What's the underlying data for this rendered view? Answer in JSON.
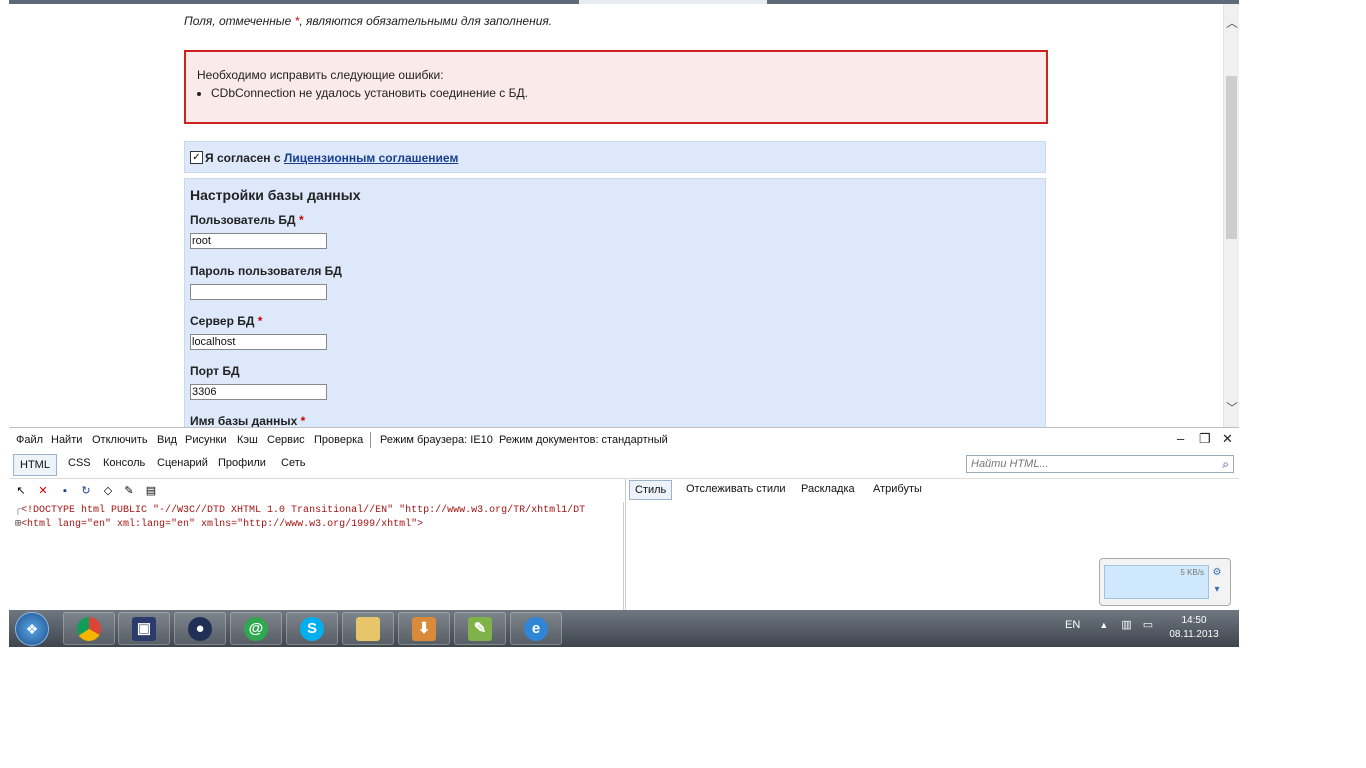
{
  "page": {
    "required_note_before": "Поля, отмеченные ",
    "required_star": "*",
    "required_note_after": ", являются обязательными для заполнения.",
    "errors": {
      "heading": "Необходимо исправить следующие ошибки:",
      "items": [
        "CDbConnection не удалось установить соединение с БД."
      ]
    },
    "license": {
      "checkbox_mark": "✓",
      "label": "Я согласен с ",
      "link": "Лицензионным соглашением",
      "checked": true
    },
    "db": {
      "title": "Настройки базы данных",
      "user_label": "Пользователь БД",
      "user_value": "root",
      "password_label": "Пароль пользователя БД",
      "password_value": "",
      "server_label": "Сервер БД",
      "server_value": "localhost",
      "port_label": "Порт БД",
      "port_value": "3306",
      "dbname_label": "Имя базы данных",
      "star": "*"
    }
  },
  "devtools": {
    "menu": [
      "Файл",
      "Найти",
      "Отключить",
      "Вид",
      "Рисунки",
      "Кэш",
      "Сервис",
      "Проверка"
    ],
    "browser_mode": "Режим браузера: IE10",
    "document_mode": "Режим документов: стандартный",
    "window_controls": [
      "–",
      "❐",
      "✕"
    ],
    "tabs": [
      "HTML",
      "CSS",
      "Консоль",
      "Сценарий",
      "Профили",
      "Сеть"
    ],
    "search_placeholder": "Найти HTML...",
    "right_tabs": [
      "Стиль",
      "Отслеживать стили",
      "Раскладка",
      "Атрибуты"
    ],
    "code_line1": "<!DOCTYPE html PUBLIC \"-//W3C//DTD XHTML 1.0 Transitional//EN\" \"http://www.w3.org/TR/xhtml1/DT",
    "code_line2": "<html lang=\"en\" xml:lang=\"en\" xmlns=\"http://www.w3.org/1999/xhtml\">"
  },
  "net_widget": {
    "rate": "5 KB/s"
  },
  "taskbar": {
    "apps": [
      "chrome-icon",
      "floppy-icon",
      "keepass-icon",
      "mail-icon",
      "skype-icon",
      "folder-icon",
      "download-icon",
      "notepad-icon",
      "ie-icon"
    ],
    "tray_lang": "EN",
    "tray_arrow": "▲",
    "time": "14:50",
    "date": "08.11.2013"
  }
}
